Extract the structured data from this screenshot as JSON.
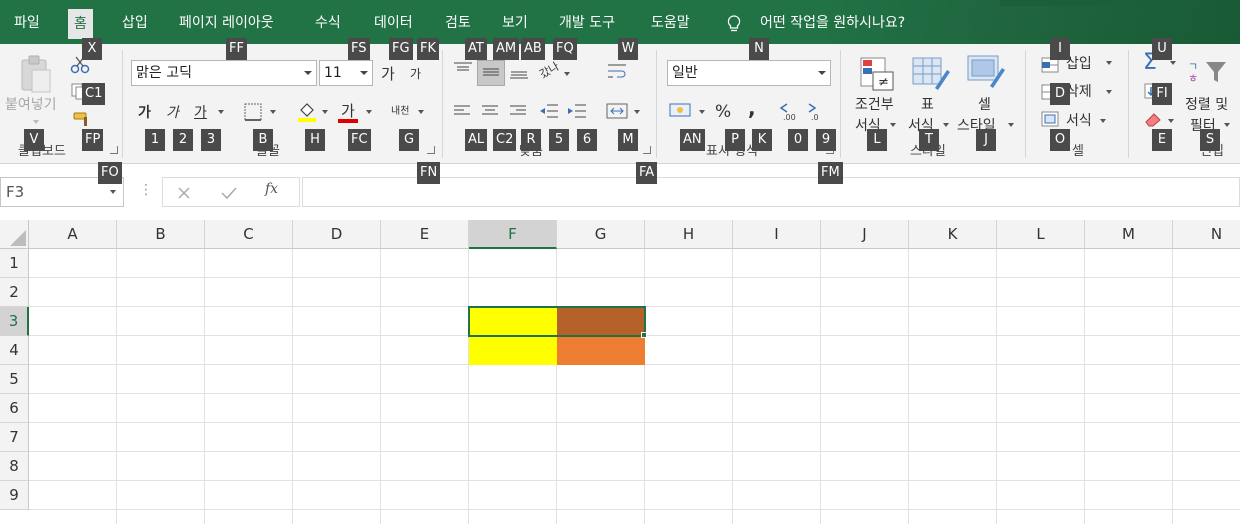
{
  "tabs": [
    "파일",
    "홈",
    "삽입",
    "페이지 레이아웃",
    "수식",
    "데이터",
    "검토",
    "보기",
    "개발 도구",
    "도움말"
  ],
  "active_tab": "홈",
  "tell_me": "어떤 작업을 원하시나요?",
  "clipboard": {
    "paste_label": "붙여넣기",
    "group_label": "클립보드"
  },
  "font": {
    "name": "맑은 고딕",
    "size": "11",
    "group_label": "글꼴",
    "bold": "가",
    "italic": "가",
    "underline": "가",
    "grow": "가",
    "shrink": "가",
    "color_letter": "가",
    "phonetic": "내천"
  },
  "alignment": {
    "group_label": "맞춤",
    "wrap": "갔나"
  },
  "number": {
    "format": "일반",
    "group_label": "표시 형식",
    "percent": "%",
    "comma": ","
  },
  "styles": {
    "conditional": "조건부",
    "conditional2": "서식",
    "table": "표",
    "table2": "서식",
    "cell": "셀",
    "cell2": "스타일",
    "group_label": "스타일"
  },
  "cells": {
    "insert": "삽입",
    "delete": "삭제",
    "format": "서식",
    "group_label": "셀"
  },
  "editing": {
    "sort": "정렬 및",
    "sort2": "필터",
    "group_label": "편집"
  },
  "keytips": [
    "X",
    "C1",
    "FP",
    "V",
    "FO",
    "FF",
    "FS",
    "FG",
    "FK",
    "1",
    "2",
    "3",
    "B",
    "H",
    "FC",
    "G",
    "FN",
    "AT",
    "AM",
    "AB",
    "FQ",
    "W",
    "AL",
    "C2",
    "R",
    "5",
    "6",
    "M",
    "FA",
    "N",
    "AN",
    "P",
    "K",
    "0",
    "9",
    "FM",
    "L",
    "T",
    "J",
    "I",
    "D",
    "O",
    "U",
    "FI",
    "E",
    "S"
  ],
  "namebox": "F3",
  "formula": "",
  "columns": [
    "A",
    "B",
    "C",
    "D",
    "E",
    "F",
    "G",
    "H",
    "I",
    "J",
    "K",
    "L",
    "M",
    "N"
  ],
  "rows": [
    "1",
    "2",
    "3",
    "4",
    "5",
    "6",
    "7",
    "8",
    "9"
  ],
  "selected_cell": "F3",
  "cell_fills": {
    "F3": "#ffff00",
    "G3": "#b5612a",
    "F4": "#ffff00",
    "G4": "#ed7d31"
  },
  "colors": {
    "accent": "#217346",
    "ribbon_bg": "#f3f3f3",
    "keytip_bg": "#4a4a4a"
  }
}
